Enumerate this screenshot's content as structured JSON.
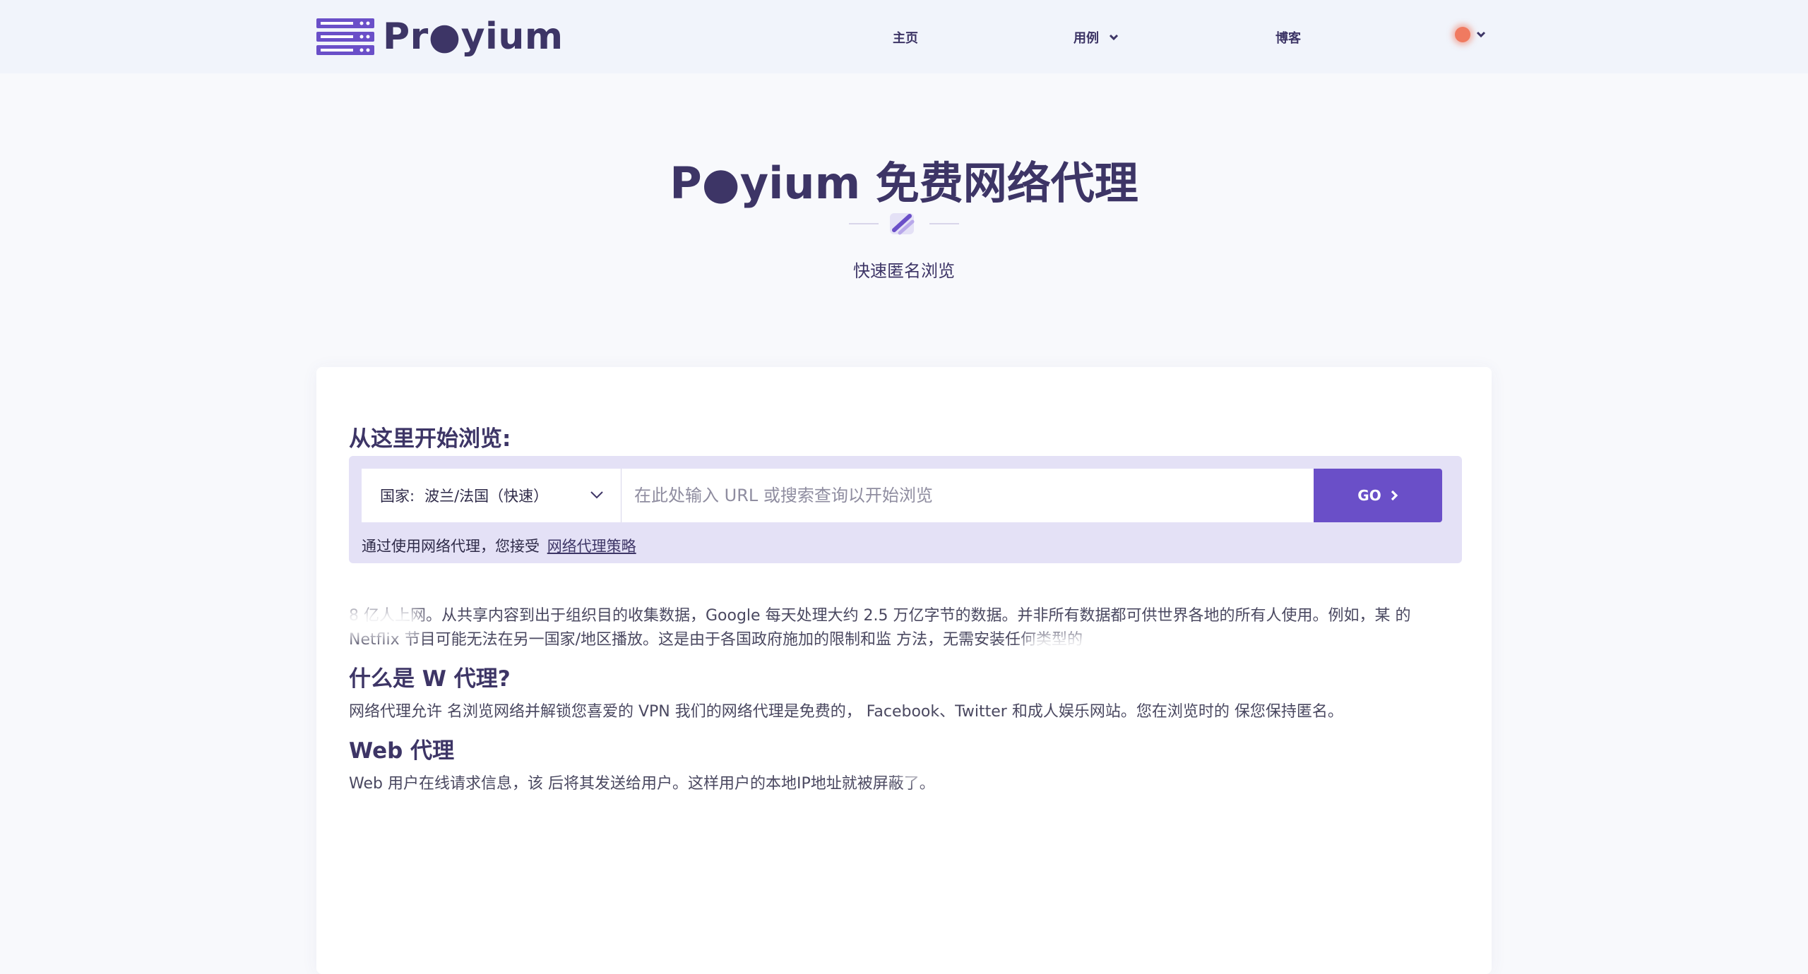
{
  "header": {
    "logo_text": "Pr●yium",
    "nav": [
      {
        "label": "主页"
      },
      {
        "label": "用例"
      },
      {
        "label": "博客"
      }
    ]
  },
  "hero": {
    "title": "P●yium 免费网络代理",
    "subtitle": "快速匿名浏览"
  },
  "browse": {
    "label": "从这里开始浏览:",
    "country_label": "国家:",
    "country_value": "波兰/法国（快速）",
    "url_placeholder": "在此处输入 URL 或搜索查询以开始浏览",
    "go_label": "GO",
    "policy_text": "通过使用网络代理，您接受",
    "policy_link": "网络代理策略"
  },
  "article": {
    "intro": "8 亿人上网。从共享内容到出于组织目的收集数据，Google 每天处理大约 2.5 万亿字节的数据。并非所有数据都可供世界各地的所有人使用。例如，某 的 Netflix 节目可能无法在另一国家/地区播放。这是由于各国政府施加的限制和监 方法，无需安装任何类型的",
    "h2_what": "什么是 W 代理?",
    "what_text": "网络代理允许 名浏览网络并解锁您喜爱的 VPN 我们的网络代理是免费的， Facebook、Twitter 和成人娱乐网站。您在浏览时的 保您保持匿名。",
    "h2_how": "Web 代理",
    "how_text": "Web 用户在线请求信息，该 后将其发送给用户。这样用户的本地IP地址就被屏蔽了。"
  },
  "colors": {
    "accent": "#6a4fc8",
    "search_bg": "#e4e1f6",
    "title": "#3d3566"
  }
}
